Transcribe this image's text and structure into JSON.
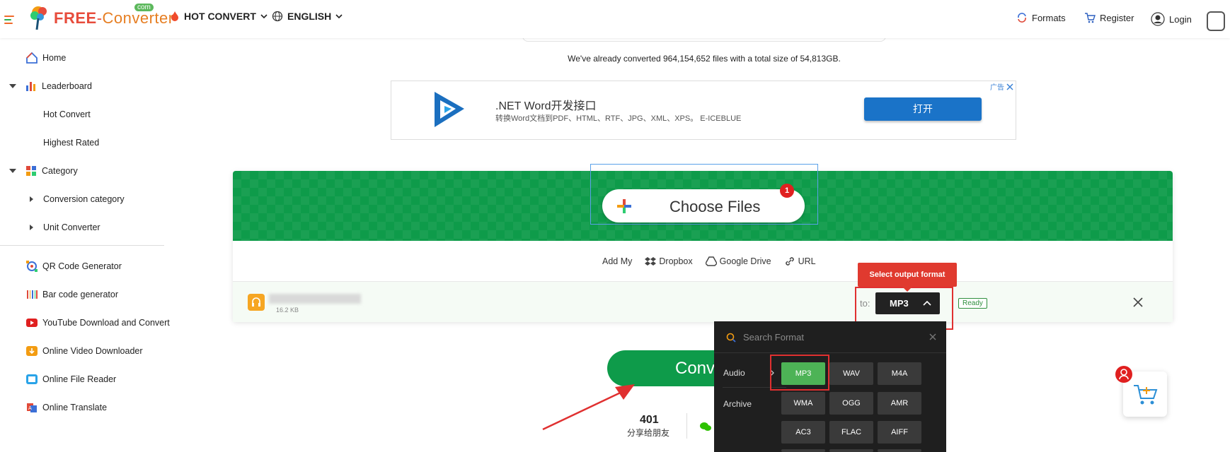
{
  "header": {
    "logo_text": "FREE-Converter",
    "logo_com": "com",
    "hot_convert": "HOT CONVERT",
    "language": "ENGLISH",
    "formats": "Formats",
    "register": "Register",
    "login": "Login"
  },
  "sidebar": {
    "home": "Home",
    "leaderboard": "Leaderboard",
    "hot_convert": "Hot Convert",
    "highest_rated": "Highest Rated",
    "category": "Category",
    "conversion_category": "Conversion category",
    "unit_converter": "Unit Converter",
    "qr_code": "QR Code Generator",
    "barcode": "Bar code generator",
    "youtube": "YouTube Download and Convert",
    "video_downloader": "Online Video Downloader",
    "file_reader": "Online File Reader",
    "translate": "Online Translate"
  },
  "stats": {
    "prefix": "We've already converted",
    "files": "964,154,652",
    "middle": "files with a total size of",
    "size": "54,813GB",
    "suffix": "."
  },
  "ad": {
    "title": ".NET Word开发接口",
    "subtitle": "转换Word文档到PDF、HTML、RTF、JPG、XML、XPS。 E-ICEBLUE",
    "button": "打开",
    "tag": "广告"
  },
  "uploader": {
    "choose_files": "Choose Files",
    "badge": "1",
    "add_my": "Add My",
    "dropbox": "Dropbox",
    "google_drive": "Google Drive",
    "url": "URL",
    "file_size": "16.2 KB",
    "to_label": "to:",
    "selected_format": "MP3",
    "tooltip": "Select output format",
    "status": "Ready"
  },
  "format_panel": {
    "search_placeholder": "Search Format",
    "categories": [
      "Audio",
      "Archive"
    ],
    "rows": [
      [
        "MP3",
        "WAV",
        "M4A"
      ],
      [
        "WMA",
        "OGG",
        "AMR"
      ],
      [
        "AC3",
        "FLAC",
        "AIFF"
      ]
    ]
  },
  "convert": {
    "label": "Conve",
    "share_count": "401",
    "share_label": "分享给朋友"
  },
  "colors": {
    "green": "#0e9b4a",
    "red": "#e03030",
    "blue": "#1a73c8"
  }
}
